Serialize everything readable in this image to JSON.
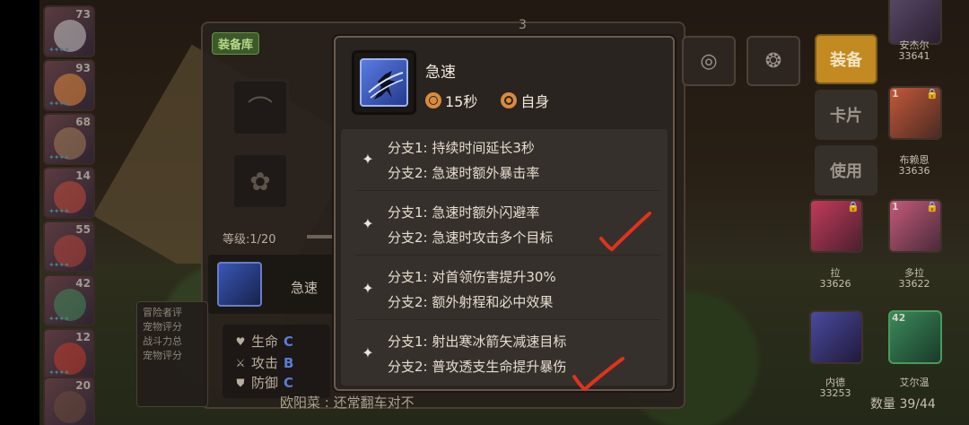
{
  "left_heroes": [
    {
      "level": "73"
    },
    {
      "level": "93"
    },
    {
      "level": "68"
    },
    {
      "level": "14"
    },
    {
      "level": "55"
    },
    {
      "level": "42"
    },
    {
      "level": "12"
    },
    {
      "level": "20"
    }
  ],
  "equip_panel": {
    "library_tag": "装备库",
    "level_text": "等级:1/20",
    "skill_name": "急速",
    "info_lines": [
      "冒险者评",
      "宠物评分",
      "战斗力总",
      "宠物评分"
    ],
    "stats": [
      {
        "label": "生命",
        "grade": "C",
        "grade_color": "#5a7bd6"
      },
      {
        "label": "攻击",
        "grade": "B",
        "grade_color": "#5a7bd6"
      },
      {
        "label": "防御",
        "grade": "C",
        "grade_color": "#5a7bd6"
      }
    ],
    "bottom_text": "欧阳菜 : 还常翻车对不"
  },
  "tooltip": {
    "title": "急速",
    "duration": "15秒",
    "target": "自身",
    "branches": [
      {
        "b1": "分支1: 持续时间延长3秒",
        "b2": "分支2: 急速时额外暴击率"
      },
      {
        "b1": "分支1: 急速时额外闪避率",
        "b2": "分支2: 急速时攻击多个目标"
      },
      {
        "b1": "分支1: 对首领伤害提升30%",
        "b2": "分支2: 额外射程和必中效果"
      },
      {
        "b1": "分支1: 射出寒冰箭矢减速目标",
        "b2": "分支2: 普攻透支生命提升暴伤"
      }
    ],
    "annotation_color": "#e0321e"
  },
  "side_buttons": {
    "equip": "装备",
    "card": "卡片",
    "use": "使用"
  },
  "right_heroes": [
    {
      "level": "",
      "name": "安杰尔",
      "power": "33641"
    },
    {
      "level": "1",
      "name": "布赖恩",
      "power": "33636"
    },
    {
      "level": "",
      "name": "拉",
      "power": "33626"
    },
    {
      "level": "1",
      "name": "多拉",
      "power": "33622"
    },
    {
      "level": "",
      "name": "内德",
      "power": "33253"
    },
    {
      "level": "42",
      "name": "艾尔温",
      "power": ""
    }
  ],
  "count_text": "数量 39/44",
  "top_number": "3"
}
